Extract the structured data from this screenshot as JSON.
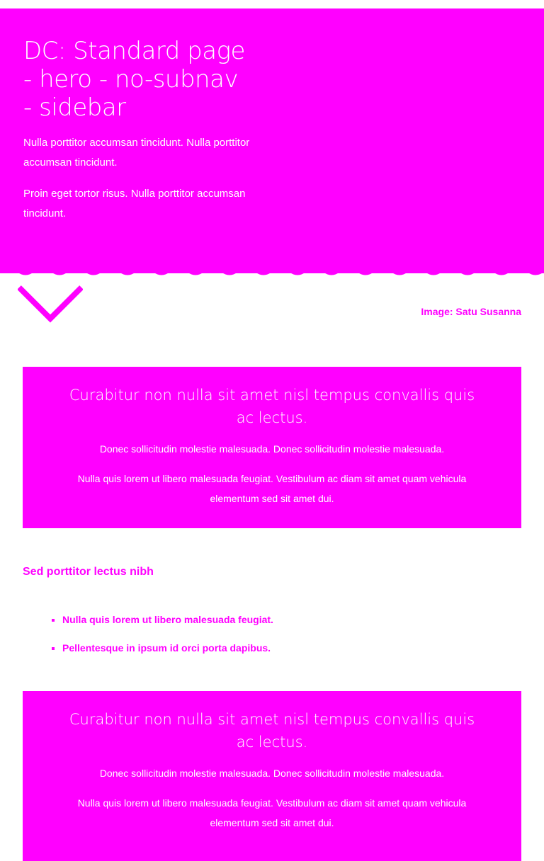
{
  "hero": {
    "title": "DC: Standard page - hero - no-subnav - sidebar",
    "paragraph1": "Nulla porttitor accumsan tincidunt. Nulla porttitor accumsan tincidunt.",
    "paragraph2": "Proin eget tortor risus. Nulla porttitor accumsan tincidunt.",
    "background_color": "#ff00ff"
  },
  "image_caption": "Image: Satu Susanna",
  "callout1": {
    "title": "Curabitur non nulla sit amet nisl tempus convallis quis ac lectus.",
    "paragraph1": "Donec sollicitudin molestie malesuada. Donec sollicitudin molestie malesuada.",
    "paragraph2": "Nulla quis lorem ut libero malesuada feugiat. Vestibulum ac diam sit amet quam vehicula elementum sed sit amet dui."
  },
  "section": {
    "heading": "Sed porttitor lectus nibh",
    "items": [
      "Nulla quis lorem ut libero malesuada feugiat.",
      "Pellentesque in ipsum id orci porta dapibus."
    ]
  },
  "callout2": {
    "title": "Curabitur non nulla sit amet nisl tempus convallis quis ac lectus.",
    "paragraph1": "Donec sollicitudin molestie malesuada. Donec sollicitudin molestie malesuada.",
    "paragraph2": "Nulla quis lorem ut libero malesuada feugiat. Vestibulum ac diam sit amet quam vehicula elementum sed sit amet dui."
  },
  "icons": {
    "scroll_down": "arrow-down-icon"
  },
  "colors": {
    "accent": "#ff00ff",
    "text_on_accent": "#ffffff"
  }
}
